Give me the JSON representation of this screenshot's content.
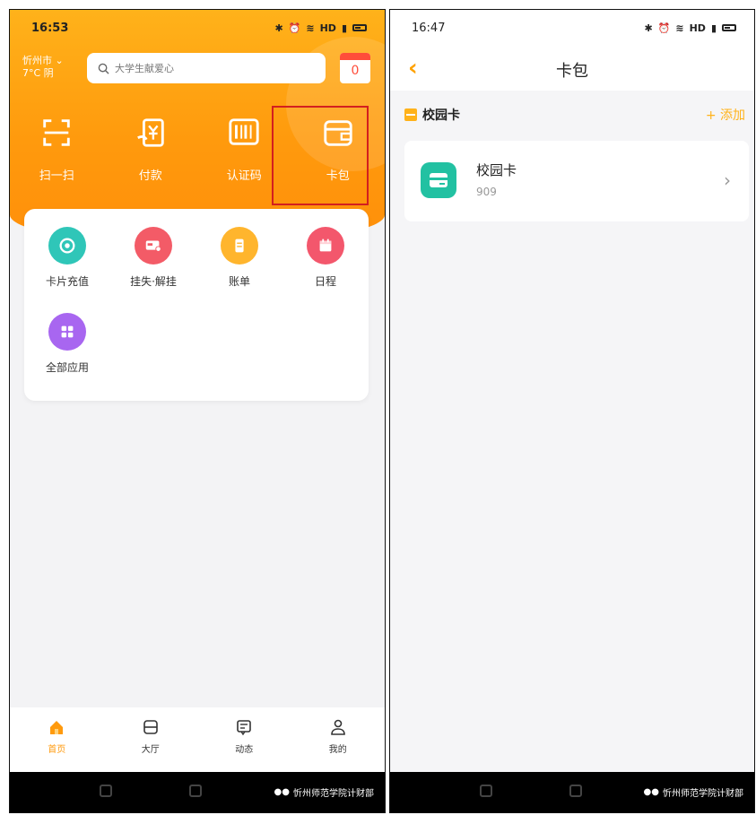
{
  "left": {
    "status": {
      "time": "16:53",
      "signal": "HD"
    },
    "location": {
      "city": "忻州市",
      "weather": "7°C 阴"
    },
    "search": {
      "placeholder": "大学生献爱心"
    },
    "calendar": {
      "count": "0"
    },
    "quick_actions": [
      {
        "label": "扫一扫",
        "icon": "scan-icon"
      },
      {
        "label": "付款",
        "icon": "payment-icon"
      },
      {
        "label": "认证码",
        "icon": "barcode-icon"
      },
      {
        "label": "卡包",
        "icon": "wallet-icon"
      }
    ],
    "apps": [
      {
        "label": "卡片充值",
        "icon": "recharge-icon",
        "color": "#2fc6b8"
      },
      {
        "label": "挂失·解挂",
        "icon": "card-lock-icon",
        "color": "#f35b67"
      },
      {
        "label": "账单",
        "icon": "bill-icon",
        "color": "#ffb52d"
      },
      {
        "label": "日程",
        "icon": "calendar-icon",
        "color": "#f3576c"
      },
      {
        "label": "全部应用",
        "icon": "grid-icon",
        "color": "#a866f0"
      }
    ],
    "tabs": [
      {
        "label": "首页",
        "icon": "home-icon",
        "active": true
      },
      {
        "label": "大厅",
        "icon": "hall-icon",
        "active": false
      },
      {
        "label": "动态",
        "icon": "message-icon",
        "active": false
      },
      {
        "label": "我的",
        "icon": "profile-icon",
        "active": false
      }
    ],
    "watermark": "忻州师范学院计财部"
  },
  "right": {
    "status": {
      "time": "16:47",
      "signal": "HD"
    },
    "title": "卡包",
    "section_title": "校园卡",
    "add_label": "+ 添加",
    "card": {
      "name": "校园卡",
      "number": "909"
    },
    "watermark": "忻州师范学院计财部"
  },
  "colors": {
    "accent": "#ff9a0d",
    "highlight_box": "#d31f1f",
    "card_green": "#22c1a2"
  }
}
